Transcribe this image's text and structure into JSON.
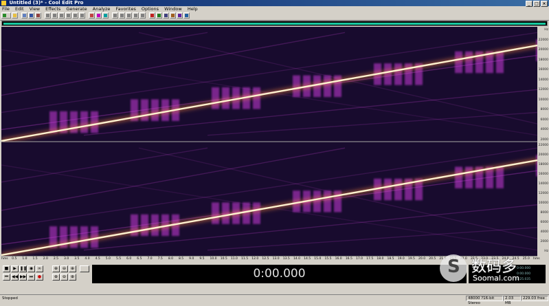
{
  "window": {
    "title": "Untitled (3)* - Cool Edit Pro",
    "controls": [
      "_",
      "□",
      "×"
    ]
  },
  "menu": [
    "File",
    "Edit",
    "View",
    "Effects",
    "Generate",
    "Analyze",
    "Favorites",
    "Options",
    "Window",
    "Help"
  ],
  "toolbar": {
    "icons": [
      "multitrack-icon",
      "new-icon",
      "open-icon",
      "save-icon",
      "close-icon",
      "cut-icon",
      "copy-icon",
      "paste-icon",
      "mix-paste-icon",
      "undo-icon",
      "repeat-icon",
      "cue-icon",
      "spectral-icon",
      "waveform-icon",
      "settings-icon",
      "play-list-icon",
      "bar-icon",
      "grid-icon",
      "scroll-icon",
      "record-icon",
      "level-icon",
      "analyze-icon",
      "pitch-icon",
      "noise-icon",
      "help-icon"
    ],
    "colors": [
      "#2a8c2a",
      "#e8c040",
      "#6080c0",
      "#3050a0",
      "#904040",
      "#808080",
      "#808080",
      "#808080",
      "#808080",
      "#808080",
      "#808080",
      "#c04040",
      "#c000c0",
      "#00a0a0",
      "#808080",
      "#808080",
      "#808080",
      "#808080",
      "#808080",
      "#c02020",
      "#208020",
      "#404080",
      "#a06020",
      "#6020a0",
      "#2060a0"
    ]
  },
  "frequency_ruler_top": [
    "Hz",
    "22000",
    "20000",
    "18000",
    "16000",
    "14000",
    "12000",
    "10000",
    "8000",
    "6000",
    "4000",
    "2000"
  ],
  "frequency_ruler_bottom": [
    "22000",
    "20000",
    "18000",
    "16000",
    "14000",
    "12000",
    "10000",
    "8000",
    "6000",
    "4000",
    "2000",
    "Hz"
  ],
  "time_axis": [
    "hms",
    "0.5",
    "1.0",
    "1.5",
    "2.0",
    "2.5",
    "3.0",
    "3.5",
    "4.0",
    "4.5",
    "5.0",
    "5.5",
    "6.0",
    "6.5",
    "7.0",
    "7.5",
    "8.0",
    "8.5",
    "9.0",
    "9.5",
    "10.0",
    "10.5",
    "11.0",
    "11.5",
    "12.0",
    "12.5",
    "13.0",
    "13.5",
    "14.0",
    "14.5",
    "15.0",
    "15.5",
    "16.0",
    "16.5",
    "17.0",
    "17.5",
    "18.0",
    "18.5",
    "19.0",
    "19.5",
    "20.0",
    "20.5",
    "21.0",
    "21.5",
    "22.0",
    "22.5",
    "23.0",
    "23.5",
    "24.0",
    "24.5",
    "25.0",
    "hms"
  ],
  "transport": {
    "row1": [
      "■",
      "▶",
      "❚❚",
      "◉",
      "∞"
    ],
    "row2": [
      "⏮",
      "◀◀",
      "▶▶",
      "⏭",
      "●"
    ],
    "zoom": [
      "⊕",
      "⊖",
      "⊕",
      "⊕",
      "⊖",
      "⊕"
    ]
  },
  "time_display": "0:00.000",
  "selection": [
    "0:00.000",
    "0:00.000",
    "0:25.035"
  ],
  "watermark": {
    "cn": "数码多",
    "en": "Soomal.com"
  },
  "status": {
    "left": "Stopped",
    "format": "48000 ?16-bit Stereo",
    "size": "2.03 MB",
    "free": "229.03 free"
  }
}
